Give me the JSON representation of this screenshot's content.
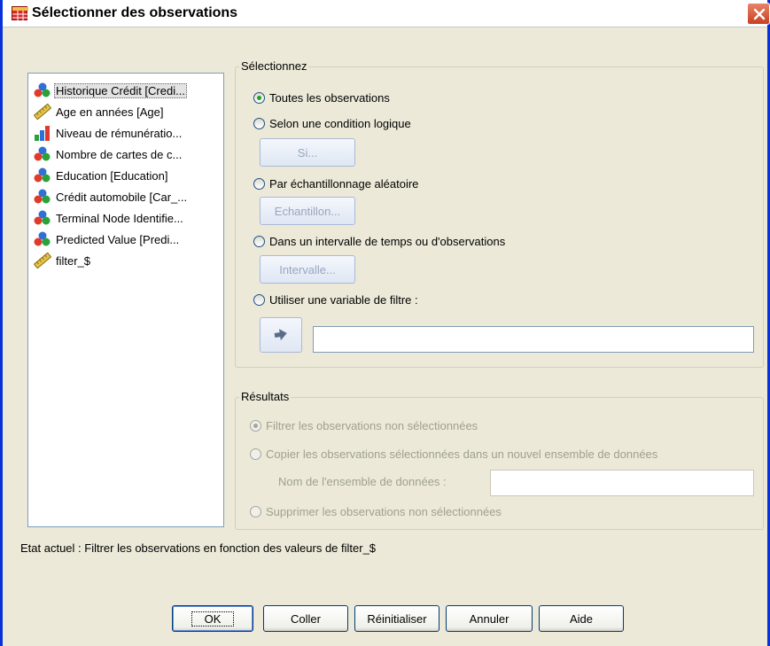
{
  "window": {
    "title": "Sélectionner des observations",
    "close_glyph": "×"
  },
  "variables": [
    {
      "label": "Historique Crédit [Credi...",
      "icon": "nominal-icon",
      "selected": true
    },
    {
      "label": "Age en années [Age]",
      "icon": "scale-icon"
    },
    {
      "label": "Niveau de rémunératio...",
      "icon": "ordinal-icon"
    },
    {
      "label": "Nombre de cartes de c...",
      "icon": "nominal-icon"
    },
    {
      "label": "Education [Education]",
      "icon": "nominal-icon"
    },
    {
      "label": "Crédit automobile [Car_...",
      "icon": "nominal-icon"
    },
    {
      "label": "Terminal Node Identifie...",
      "icon": "nominal-icon"
    },
    {
      "label": "Predicted Value [Predi...",
      "icon": "nominal-icon"
    },
    {
      "label": "filter_$",
      "icon": "scale-icon"
    }
  ],
  "select_group": {
    "legend": "Sélectionnez",
    "options": [
      {
        "label": "Toutes les observations",
        "checked": true
      },
      {
        "label": "Selon une condition logique",
        "checked": false
      },
      {
        "label": "Par échantillonnage aléatoire",
        "checked": false
      },
      {
        "label": "Dans un intervalle de temps ou d'observations",
        "checked": false
      },
      {
        "label": "Utiliser une variable de filtre :",
        "checked": false
      }
    ],
    "buttons": {
      "if_label": "Si...",
      "sample_label": "Echantillon...",
      "range_label": "Intervalle..."
    },
    "filter_value": ""
  },
  "output_group": {
    "legend": "Résultats",
    "options": [
      {
        "label": "Filtrer les observations non sélectionnées",
        "checked": true
      },
      {
        "label": "Copier les observations sélectionnées dans un nouvel ensemble de données",
        "checked": false
      },
      {
        "label": "Supprimer les observations non sélectionnées",
        "checked": false
      }
    ],
    "dataset_label": "Nom de l'ensemble de données :",
    "dataset_value": ""
  },
  "status_text": "Etat actuel : Filtrer les observations en fonction des valeurs de filter_$",
  "buttons": {
    "ok": "OK",
    "paste": "Coller",
    "reset": "Réinitialiser",
    "cancel": "Annuler",
    "help": "Aide"
  },
  "colors": {
    "accent": "#0831d9",
    "dialog_bg": "#ece9d8",
    "radio_dot": "#21a121"
  }
}
